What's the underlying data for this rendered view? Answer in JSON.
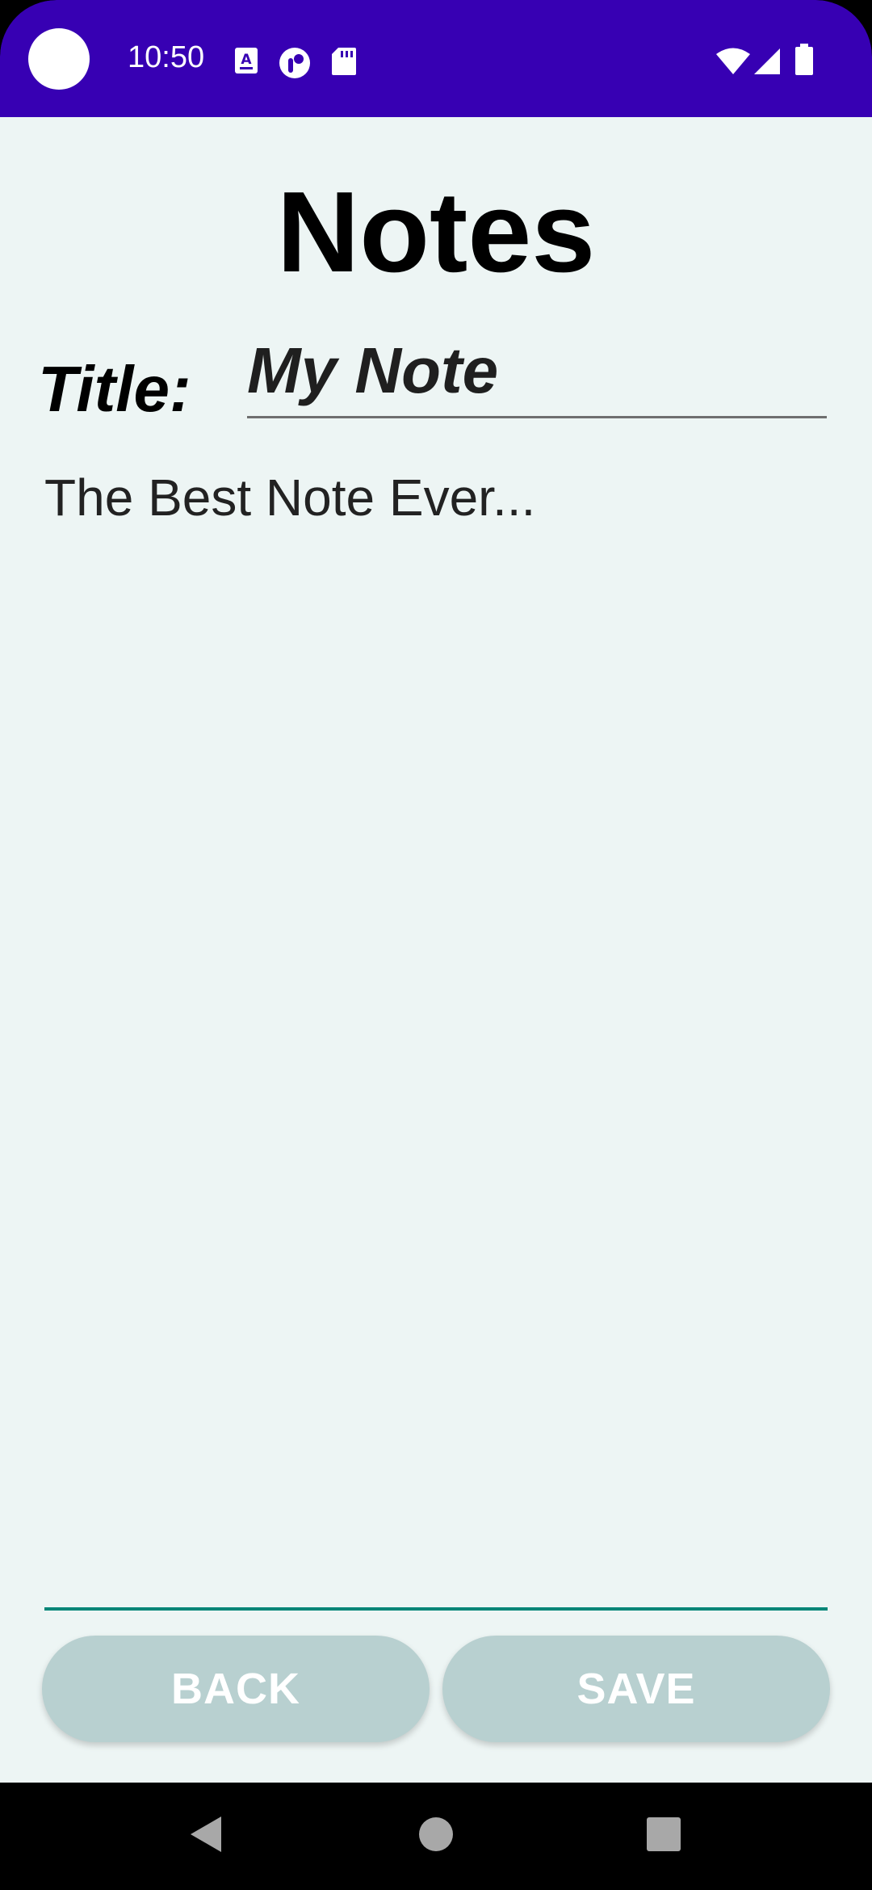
{
  "status_bar": {
    "time": "10:50",
    "background_color": "#3700b3",
    "left_icons": [
      "a-notification-icon",
      "app-notification-icon",
      "sd-card-icon"
    ],
    "right_icons": [
      "wifi-icon",
      "cell-signal-icon",
      "battery-icon"
    ]
  },
  "app": {
    "background_color": "#edf5f4",
    "page_title": "Notes",
    "title_label": "Title:",
    "title_value": "My Note",
    "body_value": "The Best Note Ever...",
    "accent_color": "#008577"
  },
  "buttons": {
    "back_label": "BACK",
    "save_label": "SAVE",
    "color": "#b8d0d0"
  },
  "nav_bar": {
    "icons": [
      "back-triangle-icon",
      "home-circle-icon",
      "recents-square-icon"
    ]
  }
}
